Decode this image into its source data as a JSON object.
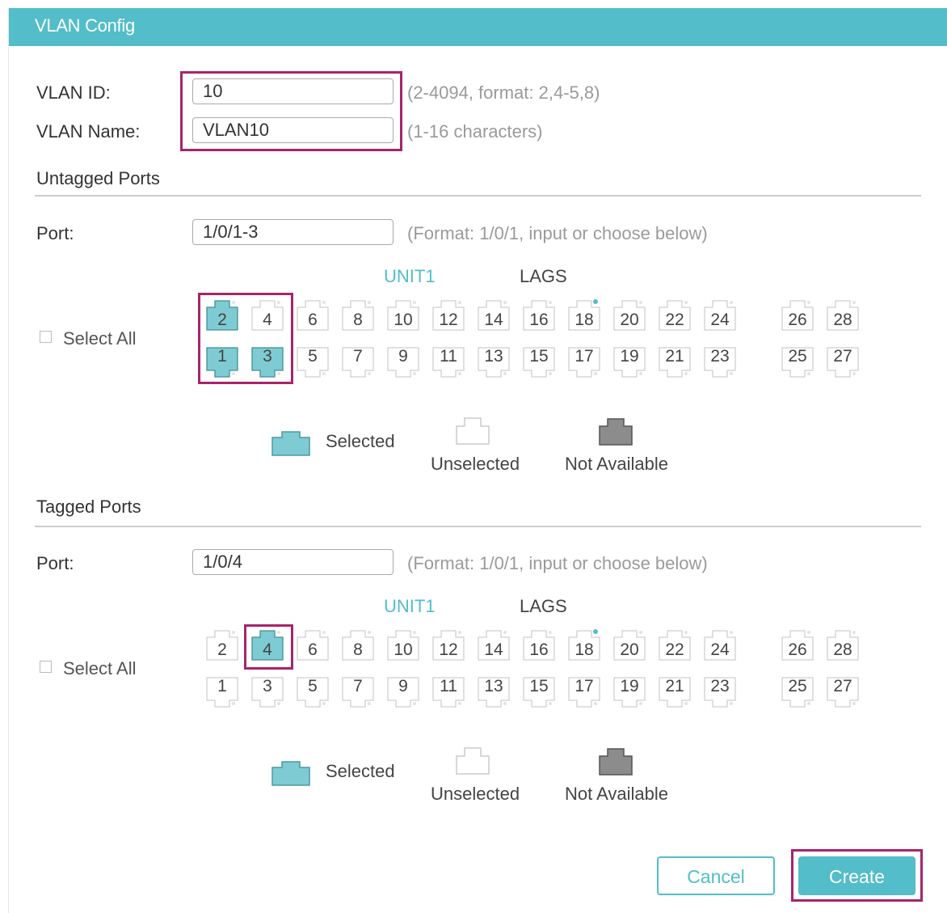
{
  "header": {
    "title": "VLAN Config"
  },
  "vlan": {
    "id_label": "VLAN ID:",
    "id_value": "10",
    "id_hint": "(2-4094, format: 2,4-5,8)",
    "name_label": "VLAN Name:",
    "name_value": "VLAN10",
    "name_hint": "(1-16 characters)"
  },
  "untagged": {
    "section_title": "Untagged Ports",
    "port_label": "Port:",
    "port_value": "1/0/1-3",
    "port_hint": "(Format: 1/0/1, input or choose below)",
    "unit_label": "UNIT1",
    "lags_label": "LAGS",
    "select_all": "Select All",
    "selected_ports": [
      "1",
      "2",
      "3"
    ]
  },
  "tagged": {
    "section_title": "Tagged Ports",
    "port_label": "Port:",
    "port_value": "1/0/4",
    "port_hint": "(Format: 1/0/1, input or choose below)",
    "unit_label": "UNIT1",
    "lags_label": "LAGS",
    "select_all": "Select All",
    "selected_ports": [
      "4"
    ]
  },
  "ports": {
    "top_row": [
      "2",
      "4",
      "6",
      "8",
      "10",
      "12",
      "14",
      "16",
      "18",
      "20",
      "22",
      "24",
      "26",
      "28"
    ],
    "bottom_row": [
      "1",
      "3",
      "5",
      "7",
      "9",
      "11",
      "13",
      "15",
      "17",
      "19",
      "21",
      "23",
      "25",
      "27"
    ],
    "indicator_port": "18"
  },
  "legend": {
    "selected": "Selected",
    "unselected": "Unselected",
    "not_available": "Not Available"
  },
  "buttons": {
    "cancel": "Cancel",
    "create": "Create"
  },
  "colors": {
    "accent": "#53bdc9",
    "selected_fill": "#7ecbd3",
    "not_available_fill": "#8c8c8c",
    "highlight_border": "#a8246b"
  }
}
